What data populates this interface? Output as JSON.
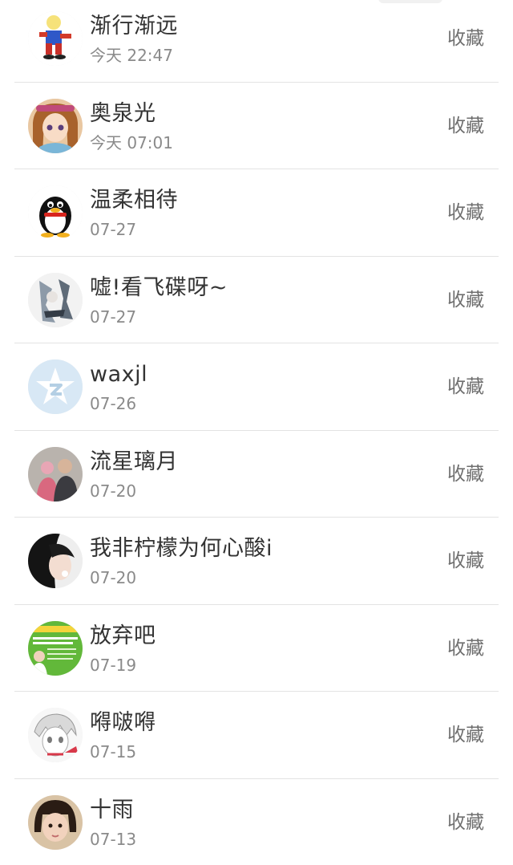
{
  "visitors": [
    {
      "name": "渐行渐远",
      "time": "今天 22:47",
      "action": "收藏",
      "avatar": "boy-figure-avatar"
    },
    {
      "name": "奥泉光",
      "time": "今天 07:01",
      "action": "收藏",
      "avatar": "anime-girl-avatar"
    },
    {
      "name": "温柔相待",
      "time": "07-27",
      "action": "收藏",
      "avatar": "qq-penguin-avatar"
    },
    {
      "name": "嘘!看飞碟呀~",
      "time": "07-27",
      "action": "收藏",
      "avatar": "sketch-avatar"
    },
    {
      "name": "waxjl",
      "time": "07-26",
      "action": "收藏",
      "avatar": "qzone-star-avatar"
    },
    {
      "name": "流星璃月",
      "time": "07-20",
      "action": "收藏",
      "avatar": "photo-people-avatar"
    },
    {
      "name": "我非柠檬为何心酸i",
      "time": "07-20",
      "action": "收藏",
      "avatar": "dark-hair-girl-avatar"
    },
    {
      "name": "放弃吧",
      "time": "07-19",
      "action": "收藏",
      "avatar": "green-poster-avatar"
    },
    {
      "name": "嘚啵嘚",
      "time": "07-15",
      "action": "收藏",
      "avatar": "anime-sketch-avatar"
    },
    {
      "name": "十雨",
      "time": "07-13",
      "action": "收藏",
      "avatar": "child-photo-avatar"
    }
  ]
}
